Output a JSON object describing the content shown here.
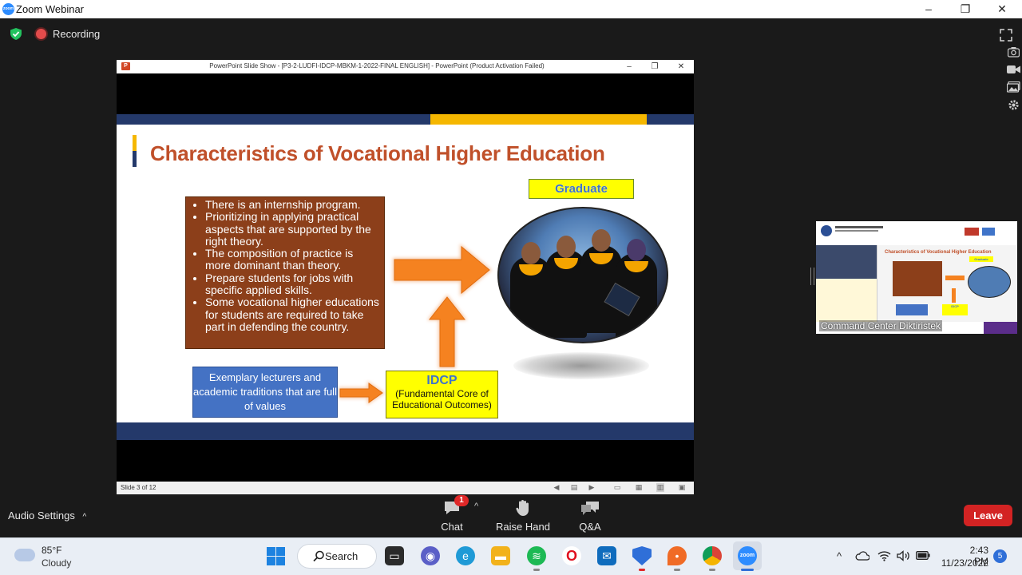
{
  "window": {
    "title": "Zoom Webinar",
    "logo_text": "zoom",
    "minimize": "–",
    "maximize": "❐",
    "close": "✕"
  },
  "topbar": {
    "recording_label": "Recording"
  },
  "ppt": {
    "window_title": "PowerPoint Slide Show - [P3-2-LUDFI-IDCP-MBKM-1-2022-FINAL ENGLISH] - PowerPoint (Product Activation Failed)",
    "status": "Slide 3 of 12",
    "app_icon_text": "P",
    "minimize": "–",
    "maximize": "❐",
    "close": "✕"
  },
  "slide": {
    "title": "Characteristics of Vocational Higher Education",
    "bullets": [
      "There is an internship program.",
      "Prioritizing in applying practical aspects that are supported by the right theory.",
      "The composition of practice is more dominant than theory.",
      "Prepare students for jobs with specific applied skills.",
      "Some vocational higher educations for students are required to take part in defending the country."
    ],
    "graduate_label": "Graduate",
    "lecturers_text": "Exemplary lecturers and academic traditions that are full of values",
    "idcp_title": "IDCP",
    "idcp_subtitle": "(Fundamental Core of Educational Outcomes)"
  },
  "thumbnail": {
    "participant_name": "Command Center Diktiristek",
    "mini_title": "Characteristics of Vocational Higher Education",
    "mini_graduate": "Graduate",
    "mini_idcp": "IDCP"
  },
  "controls": {
    "audio_settings": "Audio Settings",
    "chat_label": "Chat",
    "chat_badge": "1",
    "raise_hand_label": "Raise Hand",
    "qa_label": "Q&A",
    "leave_label": "Leave"
  },
  "taskbar": {
    "temperature": "85°F",
    "condition": "Cloudy",
    "search_label": "Search",
    "time": "2:43 PM",
    "date": "11/23/2022",
    "notification_count": "5"
  },
  "colors": {
    "zoom_blue": "#2D8CFF",
    "leave_red": "#D32323",
    "slide_navy": "#24396A",
    "slide_yellow": "#F5B700",
    "title_orange": "#C0502A",
    "list_brown": "#8C3F1A",
    "lecturer_blue": "#4472C4",
    "arrow_orange": "#F58220"
  },
  "icons": [
    "shield-icon",
    "record-icon",
    "fullscreen-icon",
    "camera-icon",
    "video-icon",
    "gallery-icon",
    "settings-icon",
    "chat-icon",
    "hand-icon",
    "qa-icon",
    "weather-icon",
    "windows-start-icon",
    "search-icon",
    "task-view-icon",
    "teams-icon",
    "edge-icon",
    "file-explorer-icon",
    "spotify-icon",
    "opera-icon",
    "mail-icon",
    "security-icon",
    "maps-icon",
    "chrome-icon",
    "zoom-icon",
    "wifi-icon",
    "volume-icon",
    "battery-icon"
  ]
}
